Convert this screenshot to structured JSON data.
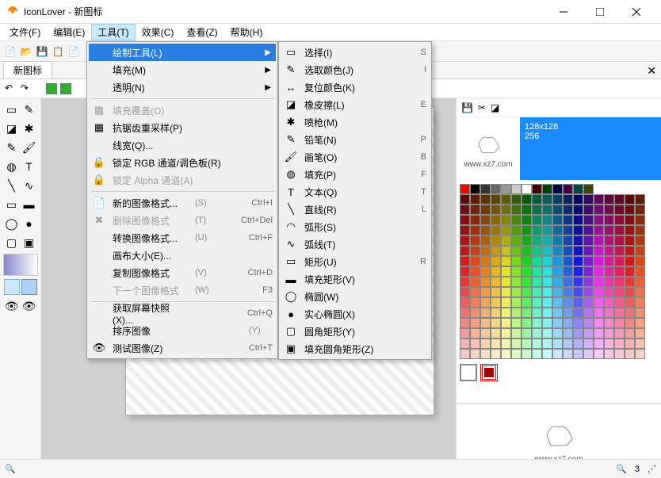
{
  "title": "IconLover - 新图标",
  "menus": [
    "文件(F)",
    "编辑(E)",
    "工具(T)",
    "效果(C)",
    "查看(Z)",
    "帮助(H)"
  ],
  "open_menu_index": 2,
  "tab": "新图标",
  "thumb_text": "www.xz7.com",
  "thumb2_line1": "128x128",
  "thumb2_line2": "256",
  "status_right": "3",
  "menu1": [
    {
      "label": "绘制工具(L)",
      "arrow": true,
      "hi": true,
      "icon": ""
    },
    {
      "label": "填充(M)",
      "arrow": true,
      "icon": ""
    },
    {
      "label": "透明(N)",
      "arrow": true,
      "icon": ""
    },
    {
      "sep": true
    },
    {
      "label": "填充覆盖(O)",
      "dis": true,
      "icon": "▦"
    },
    {
      "label": "抗锯齿重采样(P)",
      "icon": "▦"
    },
    {
      "label": "线宽(Q)...",
      "icon": ""
    },
    {
      "label": "锁定 RGB 通道/调色板(R)",
      "icon": "🔒"
    },
    {
      "label": "锁定 Alpha 通道(A)",
      "dis": true,
      "icon": "🔒"
    },
    {
      "sep": true
    },
    {
      "label": "新的图像格式...",
      "hint": "(S)",
      "short": "Ctrl+I",
      "icon": "📄"
    },
    {
      "label": "删除图像格式",
      "hint": "(T)",
      "short": "Ctrl+Del",
      "dis": true,
      "icon": "✖"
    },
    {
      "label": "转换图像格式...",
      "hint": "(U)",
      "short": "Ctrl+F",
      "icon": ""
    },
    {
      "label": "画布大小(E)...",
      "icon": ""
    },
    {
      "label": "复制图像格式",
      "hint": "(V)",
      "short": "Ctrl+D",
      "icon": ""
    },
    {
      "label": "下一个图像格式",
      "hint": "(W)",
      "short": "F3",
      "dis": true,
      "icon": ""
    },
    {
      "sep": true
    },
    {
      "label": "获取屏幕快照(X)...",
      "short": "Ctrl+Q",
      "icon": ""
    },
    {
      "label": "排序图像",
      "hint": "(Y)",
      "icon": ""
    },
    {
      "label": "测试图像(Z)",
      "short": "Ctrl+T",
      "icon": "👁"
    }
  ],
  "menu2": [
    {
      "label": "选择(I)",
      "right": "S",
      "icon": "▭"
    },
    {
      "label": "选取颜色(J)",
      "right": "I",
      "icon": "✎"
    },
    {
      "label": "复位颜色(K)",
      "icon": "↔"
    },
    {
      "label": "橡皮擦(L)",
      "right": "E",
      "icon": "◪"
    },
    {
      "label": "喷枪(M)",
      "icon": "✱"
    },
    {
      "label": "铅笔(N)",
      "right": "P",
      "icon": "✎"
    },
    {
      "label": "画笔(O)",
      "right": "B",
      "icon": "🖌"
    },
    {
      "label": "填充(P)",
      "right": "F",
      "icon": "◍"
    },
    {
      "label": "文本(Q)",
      "right": "T",
      "icon": "T"
    },
    {
      "label": "直线(R)",
      "right": "L",
      "icon": "╲"
    },
    {
      "label": "弧形(S)",
      "icon": "◠"
    },
    {
      "label": "弧线(T)",
      "icon": "∿"
    },
    {
      "label": "矩形(U)",
      "right": "R",
      "icon": "▭"
    },
    {
      "label": "填充矩形(V)",
      "icon": "▬"
    },
    {
      "label": "椭圆(W)",
      "icon": "◯"
    },
    {
      "label": "实心椭圆(X)",
      "icon": "●"
    },
    {
      "label": "圆角矩形(Y)",
      "icon": "▢"
    },
    {
      "label": "填充圆角矩形(Z)",
      "icon": "▣"
    }
  ]
}
